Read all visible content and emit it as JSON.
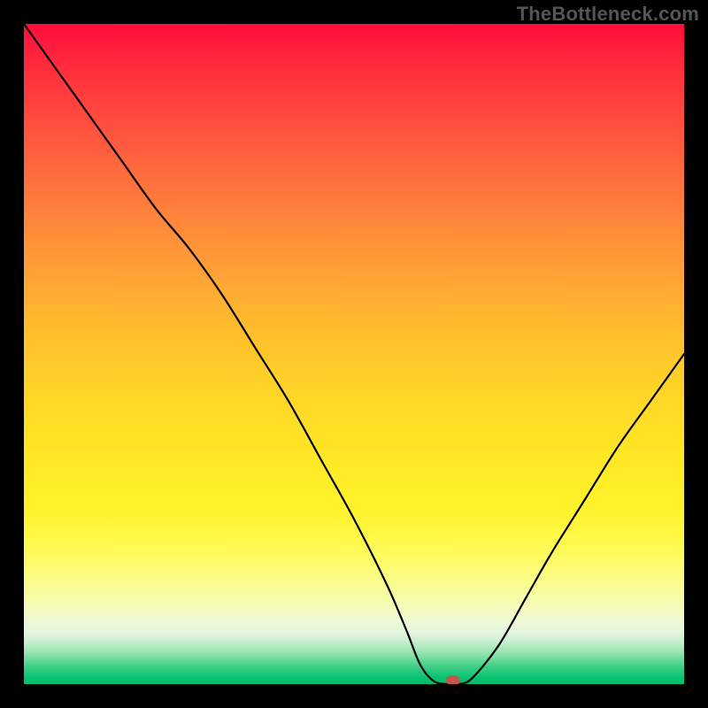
{
  "watermark": "TheBottleneck.com",
  "colors": {
    "background_black": "#000000",
    "gradient_top": "#ff0b3a",
    "gradient_mid": "#ffe826",
    "gradient_bottom": "#00be6c",
    "curve_stroke": "#000000",
    "marker_fill": "#c0574e"
  },
  "chart_data": {
    "type": "line",
    "title": "",
    "xlabel": "",
    "ylabel": "",
    "xlim": [
      0,
      100
    ],
    "ylim": [
      0,
      100
    ],
    "grid": false,
    "legend": false,
    "series": [
      {
        "name": "bottleneck-curve",
        "x": [
          0,
          5,
          10,
          15,
          20,
          25,
          30,
          35,
          40,
          45,
          50,
          55,
          58,
          60,
          62,
          64,
          66,
          68,
          72,
          76,
          80,
          85,
          90,
          95,
          100
        ],
        "y": [
          100,
          93,
          86,
          79,
          72,
          66,
          59,
          51,
          43,
          34,
          25,
          15,
          8,
          3,
          0.5,
          0,
          0,
          1,
          6,
          13,
          20,
          28,
          36,
          43,
          50
        ]
      }
    ],
    "marker": {
      "x": 65,
      "y": 0
    },
    "background_gradient_stops": [
      {
        "pos": 0.0,
        "color": "#ff0b3a"
      },
      {
        "pos": 0.3,
        "color": "#ff873b"
      },
      {
        "pos": 0.57,
        "color": "#ffd827"
      },
      {
        "pos": 0.78,
        "color": "#fff948"
      },
      {
        "pos": 0.9,
        "color": "#f0f9cf"
      },
      {
        "pos": 1.0,
        "color": "#00be6c"
      }
    ]
  }
}
